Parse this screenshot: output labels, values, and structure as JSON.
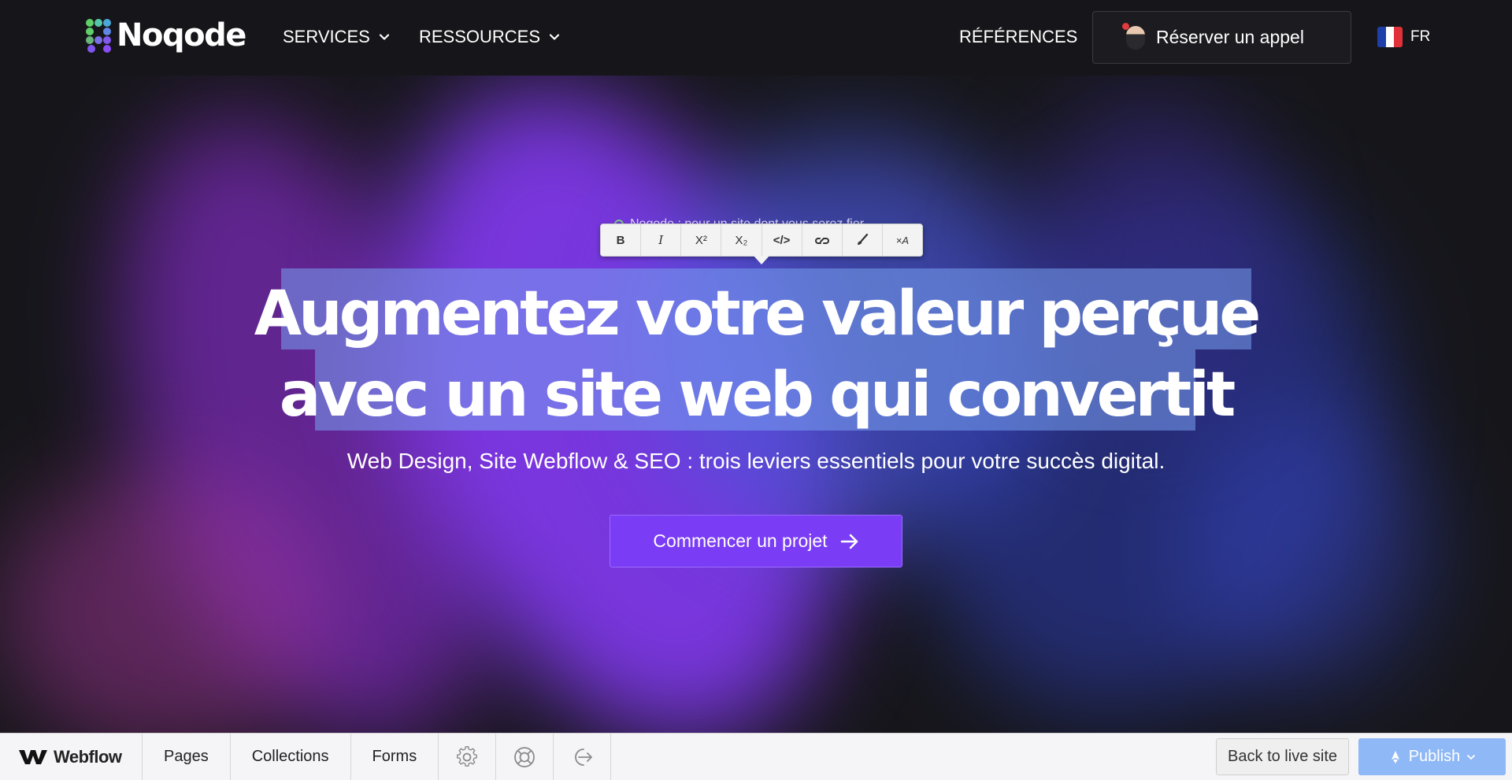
{
  "header": {
    "logo_text": "Noqode",
    "nav": {
      "services": "SERVICES",
      "ressources": "RESSOURCES",
      "references": "RÉFÉRENCES"
    },
    "cta_call": "Réserver un appel",
    "language": "FR"
  },
  "hero": {
    "eyebrow": "Noqode : pour un site dont vous serez fier",
    "headline_line1": "Augmentez votre valeur perçue",
    "headline_line2": "avec un site web qui convertit",
    "subheadline": "Web Design, Site Webflow & SEO : trois leviers essentiels pour votre succès digital.",
    "cta_project": "Commencer un projet",
    "toolbar": {
      "bold": "B",
      "italic": "I",
      "superscript": "X²",
      "subscript": "X₂",
      "code": "</>",
      "link": "link-icon",
      "brush": "brush-icon",
      "clear": "×A"
    }
  },
  "webflow_bar": {
    "brand": "Webflow",
    "tabs": [
      "Pages",
      "Collections",
      "Forms"
    ],
    "icons": [
      "gear-icon",
      "lifebuoy-icon",
      "exit-icon"
    ],
    "back_label": "Back to live site",
    "publish_label": "Publish"
  },
  "colors": {
    "background": "#16161a",
    "accent_purple": "#7a3cf5",
    "selection_blue": "#78a0f0",
    "publish_blue": "#8fb8f6"
  }
}
